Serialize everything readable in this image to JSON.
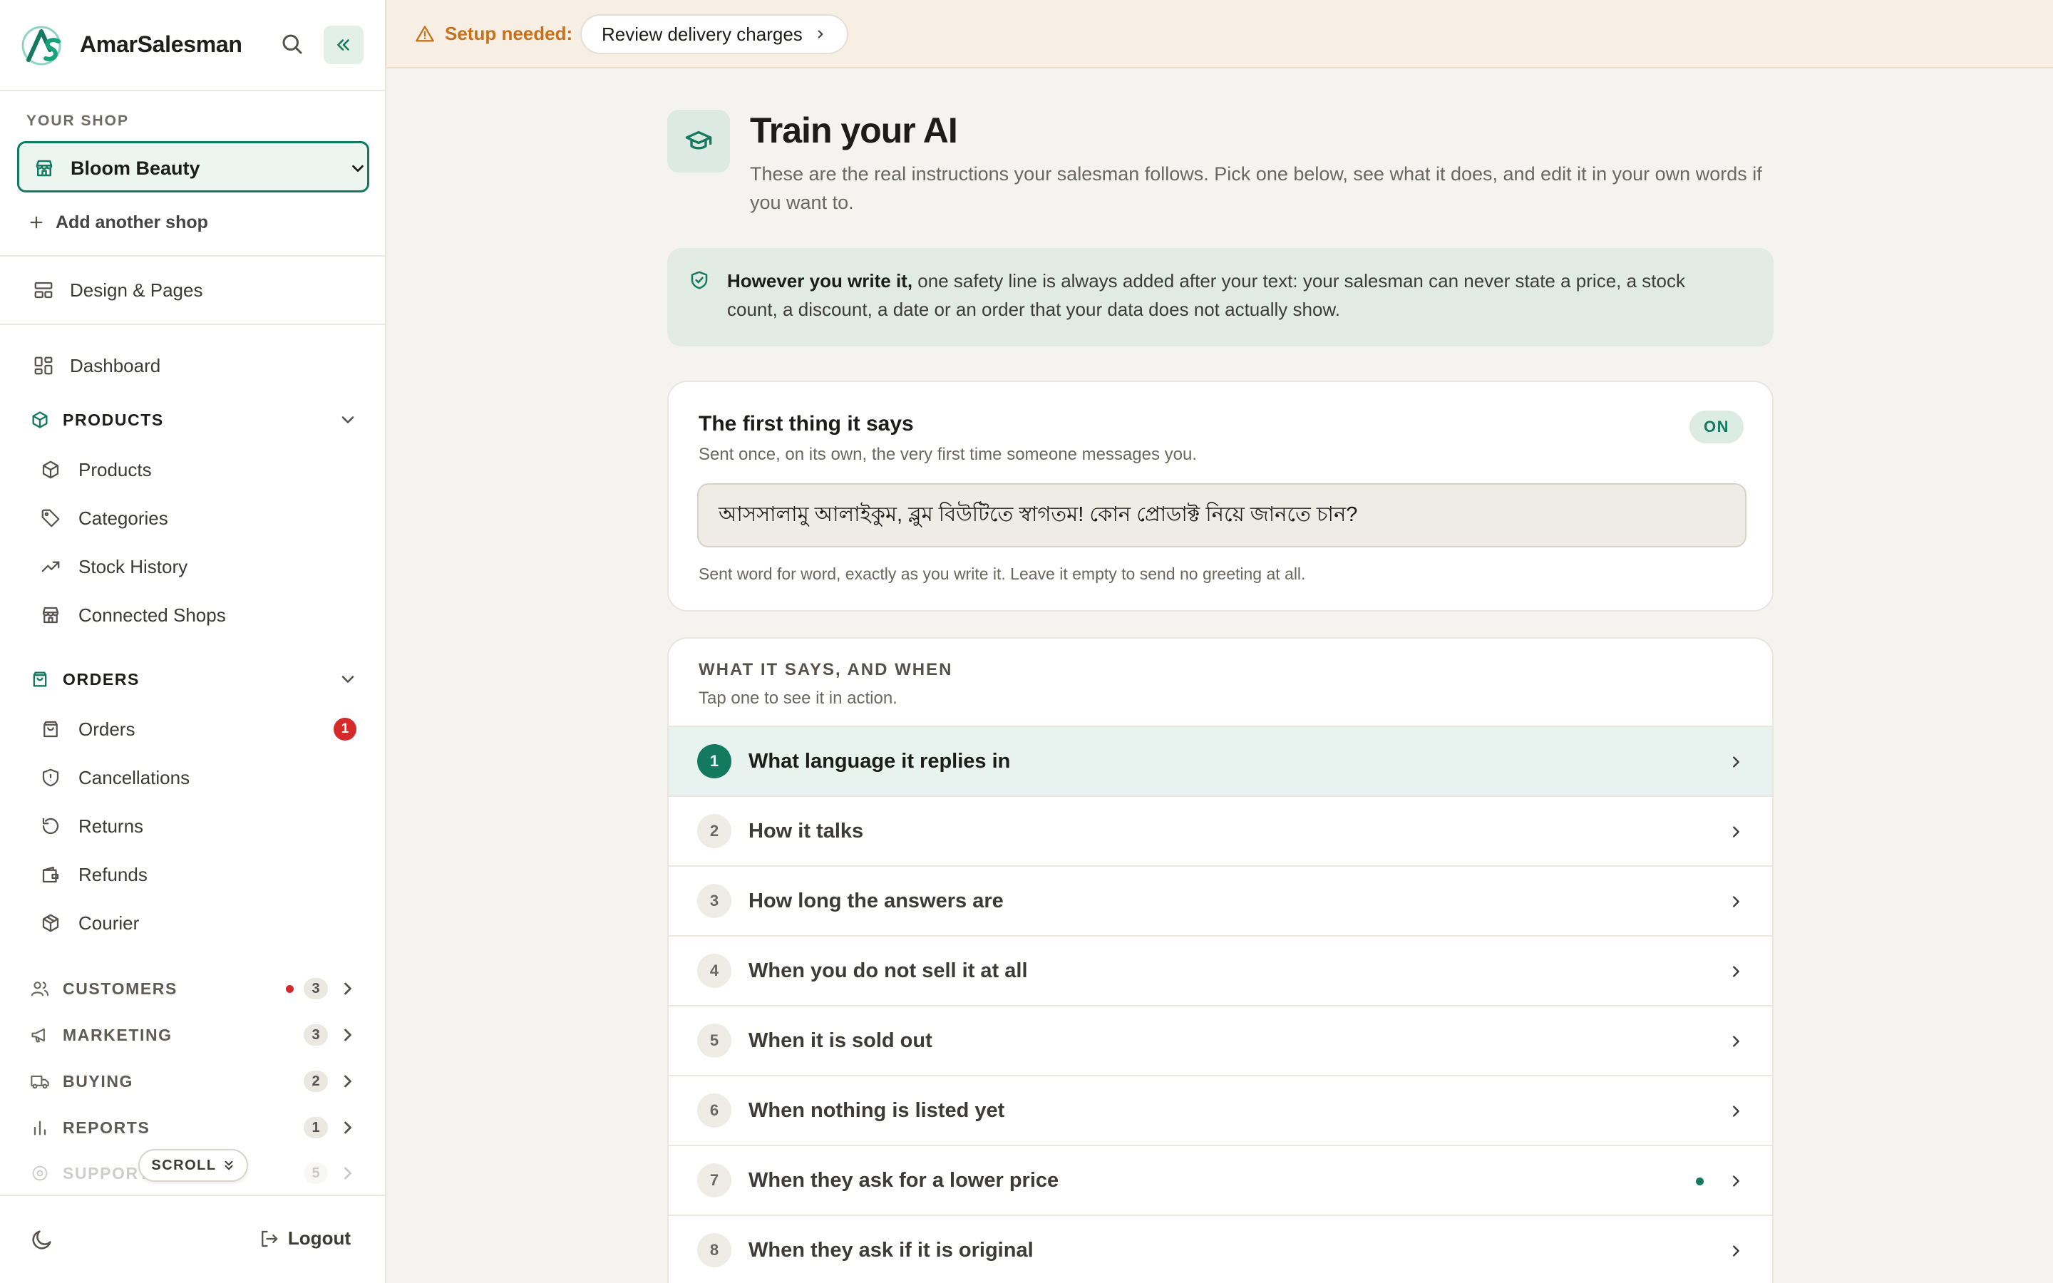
{
  "brand": {
    "name": "AmarSalesman"
  },
  "sidebar": {
    "shop_section_label": "YOUR SHOP",
    "shop_name": "Bloom Beauty",
    "add_shop": "Add another shop",
    "design_pages": "Design & Pages",
    "dashboard": "Dashboard",
    "products_group": {
      "label": "PRODUCTS",
      "items": [
        "Products",
        "Categories",
        "Stock History",
        "Connected Shops"
      ]
    },
    "orders_group": {
      "label": "ORDERS",
      "items": [
        "Orders",
        "Cancellations",
        "Returns",
        "Refunds",
        "Courier"
      ],
      "orders_badge": "1"
    },
    "collapsed_groups": [
      {
        "label": "CUSTOMERS",
        "count": "3",
        "has_alert": true
      },
      {
        "label": "MARKETING",
        "count": "3"
      },
      {
        "label": "BUYING",
        "count": "2"
      },
      {
        "label": "REPORTS",
        "count": "1"
      },
      {
        "label": "SUPPORT",
        "count": "5"
      }
    ],
    "scroll_hint": "SCROLL",
    "logout": "Logout"
  },
  "topbar": {
    "warning": "Setup needed:",
    "action": "Review delivery charges"
  },
  "main": {
    "title": "Train your AI",
    "subtitle": "These are the real instructions your salesman follows. Pick one below, see what it does, and edit it in your own words if you want to.",
    "safety_bold": "However you write it,",
    "safety_text": " one safety line is always added after your text: your salesman can never state a price, a stock count, a discount, a date or an order that your data does not actually show.",
    "greeting": {
      "title": "The first thing it says",
      "subtitle": "Sent once, on its own, the very first time someone messages you.",
      "status": "ON",
      "value": "আসসালামু আলাইকুম, ব্লুম বিউটিতে স্বাগতম! কোন প্রোডাক্ট নিয়ে জানতে চান?",
      "help": "Sent word for word, exactly as you write it. Leave it empty to send no greeting at all."
    },
    "rules": {
      "heading": "WHAT IT SAYS, AND WHEN",
      "subheading": "Tap one to see it in action.",
      "items": [
        {
          "num": "1",
          "label": "What language it replies in",
          "active": true
        },
        {
          "num": "2",
          "label": "How it talks"
        },
        {
          "num": "3",
          "label": "How long the answers are"
        },
        {
          "num": "4",
          "label": "When you do not sell it at all"
        },
        {
          "num": "5",
          "label": "When it is sold out"
        },
        {
          "num": "6",
          "label": "When nothing is listed yet"
        },
        {
          "num": "7",
          "label": "When they ask for a lower price",
          "edited": true
        },
        {
          "num": "8",
          "label": "When they ask if it is original"
        }
      ]
    }
  },
  "colors": {
    "accent": "#137a60",
    "warning": "#c7711b",
    "alert": "#d62a2a"
  }
}
